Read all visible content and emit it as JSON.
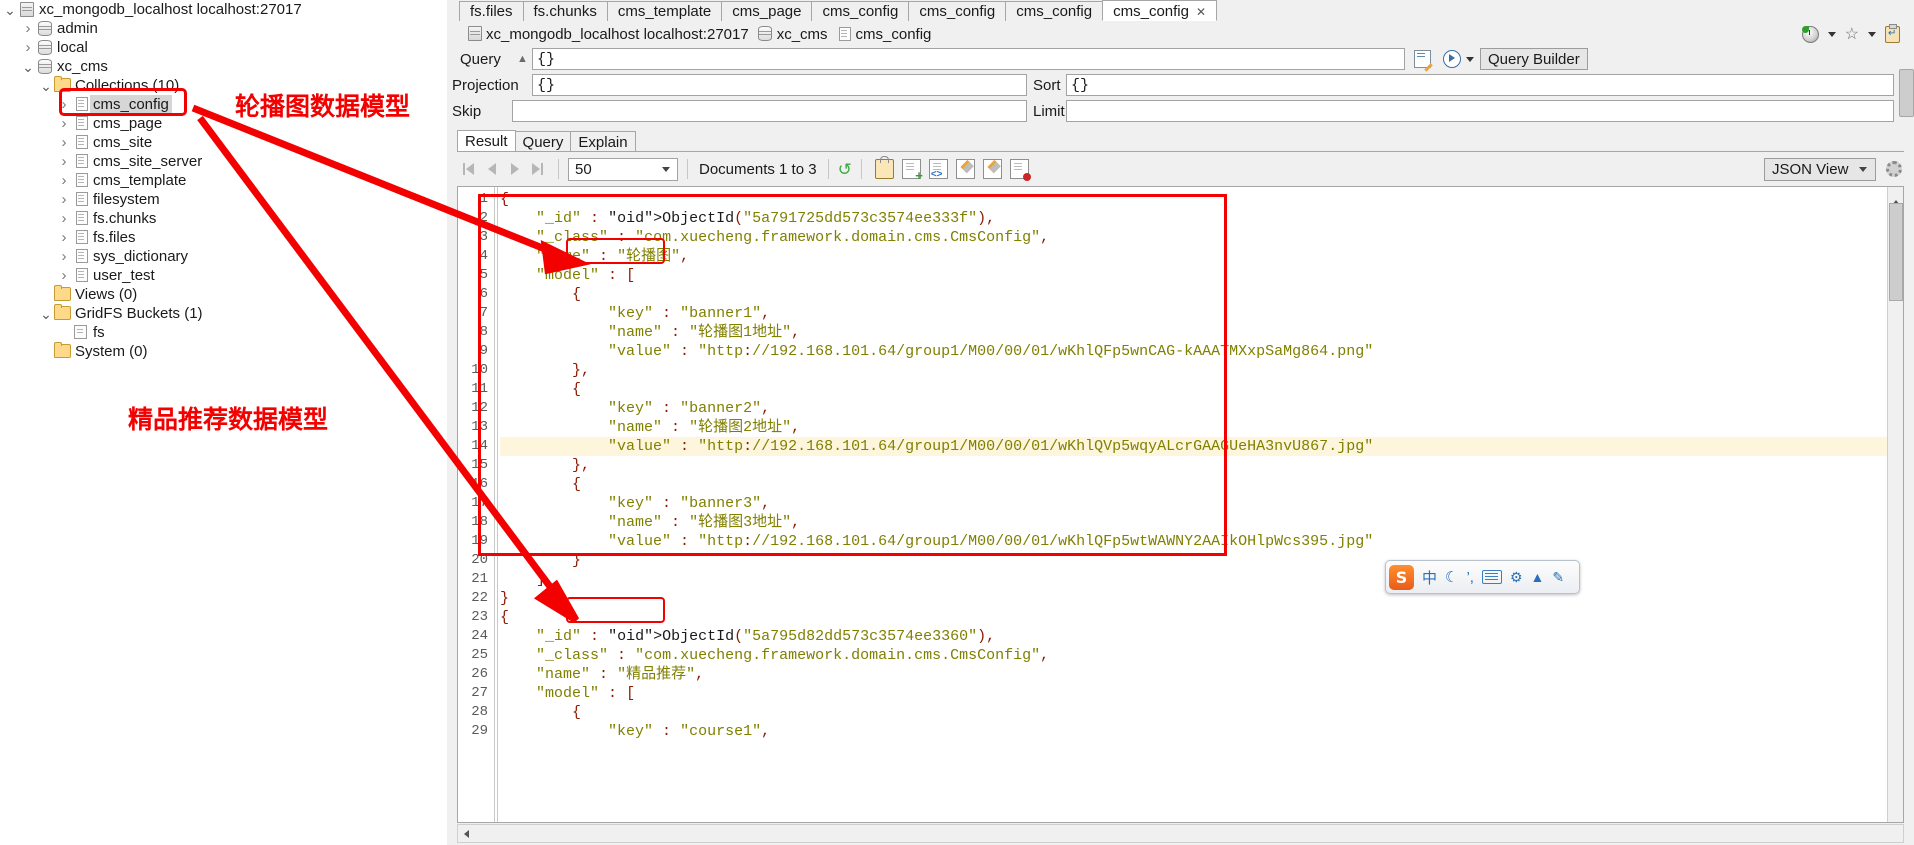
{
  "tree": {
    "nodes": [
      {
        "label": "xc_mongodb_localhost localhost:27017",
        "icon": "server-icon",
        "indent": 0,
        "twist": "open",
        "selected": false
      },
      {
        "label": "admin",
        "icon": "database-icon",
        "indent": 1,
        "twist": "closed",
        "selected": false
      },
      {
        "label": "local",
        "icon": "database-icon",
        "indent": 1,
        "twist": "closed",
        "selected": false
      },
      {
        "label": "xc_cms",
        "icon": "database-icon",
        "indent": 1,
        "twist": "open",
        "selected": false
      },
      {
        "label": "Collections (10)",
        "icon": "folder-icon",
        "indent": 2,
        "twist": "open",
        "selected": false
      },
      {
        "label": "cms_config",
        "icon": "collection-icon",
        "indent": 3,
        "twist": "closed",
        "selected": true
      },
      {
        "label": "cms_page",
        "icon": "collection-icon",
        "indent": 3,
        "twist": "closed",
        "selected": false
      },
      {
        "label": "cms_site",
        "icon": "collection-icon",
        "indent": 3,
        "twist": "closed",
        "selected": false
      },
      {
        "label": "cms_site_server",
        "icon": "collection-icon",
        "indent": 3,
        "twist": "closed",
        "selected": false
      },
      {
        "label": "cms_template",
        "icon": "collection-icon",
        "indent": 3,
        "twist": "closed",
        "selected": false
      },
      {
        "label": "filesystem",
        "icon": "collection-icon",
        "indent": 3,
        "twist": "closed",
        "selected": false
      },
      {
        "label": "fs.chunks",
        "icon": "collection-icon",
        "indent": 3,
        "twist": "closed",
        "selected": false
      },
      {
        "label": "fs.files",
        "icon": "collection-icon",
        "indent": 3,
        "twist": "closed",
        "selected": false
      },
      {
        "label": "sys_dictionary",
        "icon": "collection-icon",
        "indent": 3,
        "twist": "closed",
        "selected": false
      },
      {
        "label": "user_test",
        "icon": "collection-icon",
        "indent": 3,
        "twist": "closed",
        "selected": false
      },
      {
        "label": "Views (0)",
        "icon": "folder-icon",
        "indent": 2,
        "twist": "none",
        "selected": false
      },
      {
        "label": "GridFS Buckets (1)",
        "icon": "folder-icon",
        "indent": 2,
        "twist": "open",
        "selected": false
      },
      {
        "label": "fs",
        "icon": "gridfs-icon",
        "indent": 3,
        "twist": "none",
        "selected": false
      },
      {
        "label": "System (0)",
        "icon": "folder-icon",
        "indent": 2,
        "twist": "none",
        "selected": false
      }
    ]
  },
  "annotations": {
    "color": "#f30000",
    "labels": [
      {
        "text": "轮播图数据模型",
        "target": "cms_config tree node"
      },
      {
        "text": "精品推荐数据模型",
        "target": "second document name"
      }
    ]
  },
  "tabs": {
    "items": [
      {
        "label": "fs.files",
        "active": false,
        "closable": false
      },
      {
        "label": "fs.chunks",
        "active": false,
        "closable": false
      },
      {
        "label": "cms_template",
        "active": false,
        "closable": false
      },
      {
        "label": "cms_page",
        "active": false,
        "closable": false
      },
      {
        "label": "cms_config",
        "active": false,
        "closable": false
      },
      {
        "label": "cms_config",
        "active": false,
        "closable": false
      },
      {
        "label": "cms_config",
        "active": false,
        "closable": false
      },
      {
        "label": "cms_config",
        "active": true,
        "closable": true
      }
    ],
    "close_glyph": "✕"
  },
  "breadcrumb": {
    "server": "xc_mongodb_localhost localhost:27017",
    "database": "xc_cms",
    "collection": "cms_config",
    "tools": [
      "history-icon",
      "chevron-down-icon",
      "favorite-star-icon",
      "chevron-down-icon",
      "clipboard-icon"
    ]
  },
  "query_form": {
    "query_label": "Query",
    "query_value": "{}",
    "projection_label": "Projection",
    "projection_value": "{}",
    "skip_label": "Skip",
    "skip_value": "",
    "sort_label": "Sort",
    "sort_value": "{}",
    "limit_label": "Limit",
    "limit_value": "",
    "query_builder_button": "Query Builder",
    "edit_icon": "edit-query-icon",
    "run_icon": "run-query-icon"
  },
  "result_tabs": [
    {
      "label": "Result",
      "active": true
    },
    {
      "label": "Query",
      "active": false
    },
    {
      "label": "Explain",
      "active": false
    }
  ],
  "result_toolbar": {
    "page_size": "50",
    "documents_info": "Documents 1 to 3",
    "refresh_icon": "refresh-icon",
    "icons": [
      "lock-icon",
      "new-document-icon",
      "view-source-icon",
      "edit-document-icon",
      "copy-document-icon",
      "delete-document-icon"
    ],
    "view_mode": "JSON View",
    "settings_icon": "gear-icon"
  },
  "json_document": {
    "lines": [
      {
        "n": 1,
        "indent": 0,
        "text": "{"
      },
      {
        "n": 2,
        "indent": 1,
        "text": "\"_id\" : ObjectId(\"5a791725dd573c3574ee333f\"),"
      },
      {
        "n": 3,
        "indent": 1,
        "text": "\"_class\" : \"com.xuecheng.framework.domain.cms.CmsConfig\","
      },
      {
        "n": 4,
        "indent": 1,
        "text": "\"name\" : \"轮播图\","
      },
      {
        "n": 5,
        "indent": 1,
        "text": "\"model\" : ["
      },
      {
        "n": 6,
        "indent": 2,
        "text": "{"
      },
      {
        "n": 7,
        "indent": 3,
        "text": "\"key\" : \"banner1\","
      },
      {
        "n": 8,
        "indent": 3,
        "text": "\"name\" : \"轮播图1地址\","
      },
      {
        "n": 9,
        "indent": 3,
        "text": "\"value\" : \"http://192.168.101.64/group1/M00/00/01/wKhlQFp5wnCAG-kAAATMXxpSaMg864.png\""
      },
      {
        "n": 10,
        "indent": 2,
        "text": "},"
      },
      {
        "n": 11,
        "indent": 2,
        "text": "{"
      },
      {
        "n": 12,
        "indent": 3,
        "text": "\"key\" : \"banner2\","
      },
      {
        "n": 13,
        "indent": 3,
        "text": "\"name\" : \"轮播图2地址\","
      },
      {
        "n": 14,
        "indent": 3,
        "text": "\"value\" : \"http://192.168.101.64/group1/M00/00/01/wKhlQVp5wqyALcrGAAGUeHA3nvU867.jpg\"",
        "highlight": true
      },
      {
        "n": 15,
        "indent": 2,
        "text": "},"
      },
      {
        "n": 16,
        "indent": 2,
        "text": "{"
      },
      {
        "n": 17,
        "indent": 3,
        "text": "\"key\" : \"banner3\","
      },
      {
        "n": 18,
        "indent": 3,
        "text": "\"name\" : \"轮播图3地址\","
      },
      {
        "n": 19,
        "indent": 3,
        "text": "\"value\" : \"http://192.168.101.64/group1/M00/00/01/wKhlQFp5wtWAWNY2AAIkOHlpWcs395.jpg\""
      },
      {
        "n": 20,
        "indent": 2,
        "text": "}"
      },
      {
        "n": 21,
        "indent": 1,
        "text": "]"
      },
      {
        "n": 22,
        "indent": 0,
        "text": "}"
      },
      {
        "n": 23,
        "indent": 0,
        "text": "{"
      },
      {
        "n": 24,
        "indent": 1,
        "text": "\"_id\" : ObjectId(\"5a795d82dd573c3574ee3360\"),"
      },
      {
        "n": 25,
        "indent": 1,
        "text": "\"_class\" : \"com.xuecheng.framework.domain.cms.CmsConfig\","
      },
      {
        "n": 26,
        "indent": 1,
        "text": "\"name\" : \"精品推荐\","
      },
      {
        "n": 27,
        "indent": 1,
        "text": "\"model\" : ["
      },
      {
        "n": 28,
        "indent": 2,
        "text": "{"
      },
      {
        "n": 29,
        "indent": 3,
        "text": "\"key\" : \"course1\","
      }
    ]
  },
  "ime": {
    "logo": "S",
    "mode": "中",
    "items": [
      "moon-icon",
      "comma-icon",
      "keyboard-icon",
      "toolbox-icon",
      "up-arrow-icon",
      "wrench-icon"
    ]
  }
}
